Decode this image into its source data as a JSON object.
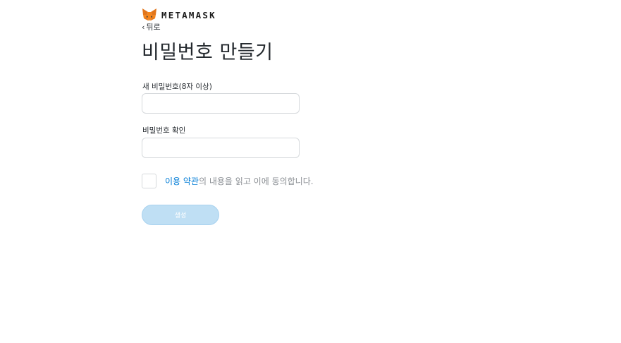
{
  "header": {
    "brand": "METAMASK",
    "logo_icon": "metamask-fox-icon"
  },
  "nav": {
    "back_label": "뒤로",
    "back_icon": "chevron-left-icon"
  },
  "form": {
    "title": "비밀번호 만들기",
    "new_password_label": "새 비밀번호(8자 이상)",
    "new_password_value": "",
    "confirm_password_label": "비밀번호 확인",
    "confirm_password_value": "",
    "terms_link_text": "이용 약관",
    "terms_rest_text": "의 내용을 읽고 이에 동의합니다.",
    "terms_checked": false,
    "create_button_label": "생성",
    "create_button_disabled": true
  },
  "colors": {
    "link": "#037dd6",
    "button_disabled_bg": "#bfdff4",
    "input_border": "#d6d9dc",
    "fox_orange": "#e2761b"
  }
}
